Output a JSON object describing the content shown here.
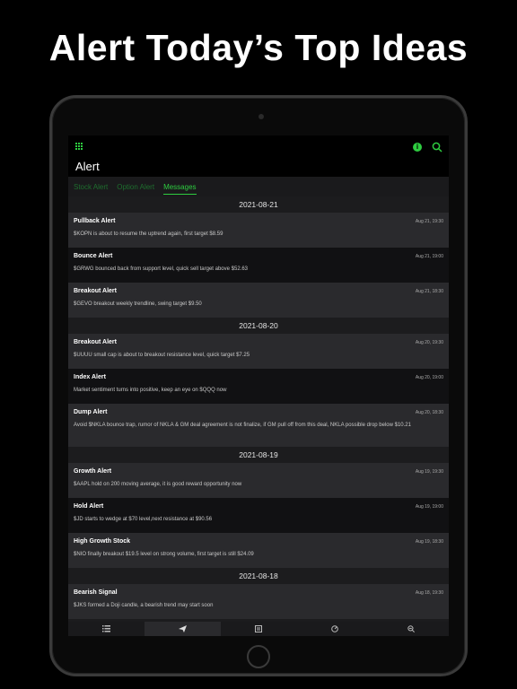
{
  "headline": "Alert Today’s Top Ideas",
  "app": {
    "title": "Alert",
    "tabs": [
      {
        "label": "Stock Alert"
      },
      {
        "label": "Option Alert"
      },
      {
        "label": "Messages"
      }
    ],
    "active_tab": "Messages",
    "colors": {
      "accent": "#2ecc40",
      "feed_bg": "#1c1c1e",
      "row_alt": "#2a2a2d"
    }
  },
  "groups": [
    {
      "date": "2021-08-21",
      "items": [
        {
          "title": "Pullback Alert",
          "time": "Aug 21, 19:30",
          "msg": "$KOPN is about to resume the uptrend again, first target $8.59"
        },
        {
          "title": "Bounce Alert",
          "time": "Aug 21, 19:00",
          "msg": "$GRWG bounced back from support level, quick sell target above $52.63"
        },
        {
          "title": "Breakout Alert",
          "time": "Aug 21, 18:30",
          "msg": "$GEVO breakout weekly trendline, swing target $9.50"
        }
      ]
    },
    {
      "date": "2021-08-20",
      "items": [
        {
          "title": "Breakout Alert",
          "time": "Aug 20, 19:30",
          "msg": "$UUUU small cap is about to breakout resistance level, quick target $7.25"
        },
        {
          "title": "Index Alert",
          "time": "Aug 20, 19:00",
          "msg": "Market sentiment turns into positive, keep an eye on $QQQ now"
        },
        {
          "title": "Dump Alert",
          "time": "Aug 20, 18:30",
          "msg": "Avoid $NKLA bounce trap, rumor of NKLA & GM deal agreement is not finalize, if GM pull off from this deal, NKLA possible drop below $10.21"
        }
      ]
    },
    {
      "date": "2021-08-19",
      "items": [
        {
          "title": "Growth Alert",
          "time": "Aug 19, 19:30",
          "msg": "$AAPL hold on 200 moving average, it is good reward opportunity now"
        },
        {
          "title": "Hold Alert",
          "time": "Aug 19, 19:00",
          "msg": "$JD starts to wedge at $70 level,next resistance at $90.56"
        },
        {
          "title": "High Growth Stock",
          "time": "Aug 19, 18:30",
          "msg": "$NIO finally breakout $19.5 level on strong volume, first target is still $24.09"
        }
      ]
    },
    {
      "date": "2021-08-18",
      "items": [
        {
          "title": "Bearish Signal",
          "time": "Aug 18, 19:30",
          "msg": "$JKS formed a Doji candle, a bearish trend may start soon"
        }
      ]
    }
  ],
  "bottom_nav": [
    {
      "icon": "list-icon"
    },
    {
      "icon": "send-icon"
    },
    {
      "icon": "news-icon"
    },
    {
      "icon": "gauge-icon"
    },
    {
      "icon": "zoom-out-icon"
    }
  ]
}
